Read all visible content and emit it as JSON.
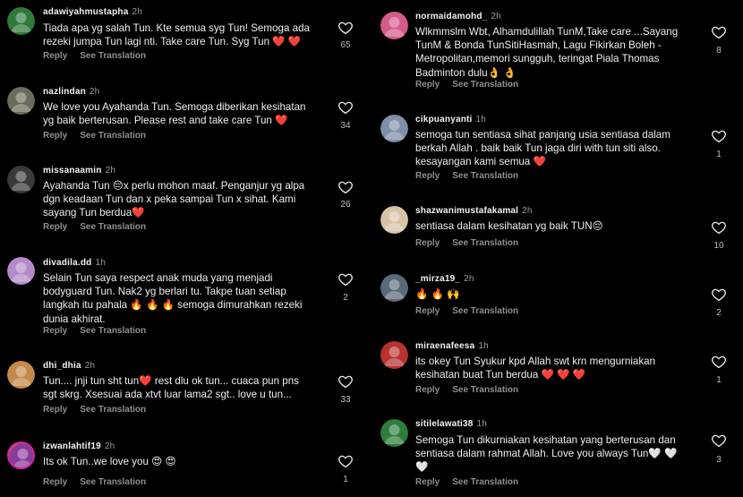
{
  "ui": {
    "reply_label": "Reply",
    "translate_label": "See Translation"
  },
  "left": [
    {
      "username": "adawiyahmustapha",
      "time": "2h",
      "text": "Tiada apa yg salah Tun. Kte semua syg Tun! Semoga ada\nrezeki jumpa Tun lagi nti. Take care Tun. Syg Tun ❤️ ❤️",
      "likes": "65",
      "avatar": "#2f7a3a"
    },
    {
      "username": "nazlindan",
      "time": "2h",
      "text": "We love you Ayahanda Tun. Semoga diberikan kesihatan\nyg baik berterusan. Please rest and take care Tun ❤️",
      "likes": "34",
      "avatar": "#6b6b5a"
    },
    {
      "username": "missanaamin",
      "time": "2h",
      "text": "Ayahanda Tun 😔x perlu mohon maaf. Penganjur yg alpa\ndgn keadaan Tun dan x peka sampai Tun x sihat. Kami\nsayang Tun berdua❤️",
      "likes": "26",
      "avatar": "#3a3a3a"
    },
    {
      "username": "divadila.dd",
      "time": "1h",
      "text": "Selain Tun saya respect anak muda yang menjadi\nbodyguard Tun. Nak2 yg berlari tu. Takpe tuan setiap\nlangkah itu pahala 🔥 🔥 🔥 semoga dimurahkan rezeki\ndunia akhirat.",
      "likes": "2",
      "avatar": "#b58ac9"
    },
    {
      "username": "dhi_dhia",
      "time": "2h",
      "text": "Tun.... jnji tun sht tun❤️ rest dlu ok tun... cuaca pun pns\nsgt skrg. Xsesuai ada xtvt luar lama2 sgt.. love u tun...",
      "likes": "33",
      "avatar": "#c48a4a"
    },
    {
      "username": "izwanlahtif19",
      "time": "2h",
      "text": "Its ok Tun..we love you 😍 😍",
      "likes": "1",
      "avatar": "#8a3b9a"
    }
  ],
  "right": [
    {
      "username": "normaidamohd_",
      "time": "2h",
      "text": "Wlkmmslm Wbt, Alhamdulillah TunM,Take care ...Sayang\nTunM & Bonda TunSitiHasmah, Lagu Fikirkan Boleh -\nMetropolitan,memori sungguh, teringat Piala Thomas\nBadminton dulu👌 👌",
      "likes": "8",
      "avatar": "#d45b8a"
    },
    {
      "username": "cikpuanyanti",
      "time": "1h",
      "text": "semoga tun sentiasa sihat panjang usia sentiasa dalam\nberkah Allah . baik baik Tun jaga diri with tun siti also.\nkesayangan kami semua ❤️",
      "likes": "1",
      "avatar": "#7f8fa8"
    },
    {
      "username": "shazwanimustafakamal",
      "time": "2h",
      "text": "sentiasa dalam kesihatan yg baik TUN😔",
      "likes": "10",
      "avatar": "#d9c3a8"
    },
    {
      "username": "_mirza19_",
      "time": "2h",
      "text": "🔥 🔥 🙌",
      "likes": "2",
      "avatar": "#5a6a7a"
    },
    {
      "username": "miraenafeesa",
      "time": "1h",
      "text": "its okey Tun Syukur kpd Allah swt krn mengurniakan\nkesihatan buat Tun berdua ❤️ ❤️ ❤️",
      "likes": "1",
      "avatar": "#b8322f"
    },
    {
      "username": "sitilelawati38",
      "time": "1h",
      "text": "Semoga Tun dikurniakan kesihatan yang berterusan dan\nsentiasa dalam rahmat Allah. Love you always Tun🤍 🤍\n🤍",
      "likes": "3",
      "avatar": "#2e7d3b"
    }
  ]
}
